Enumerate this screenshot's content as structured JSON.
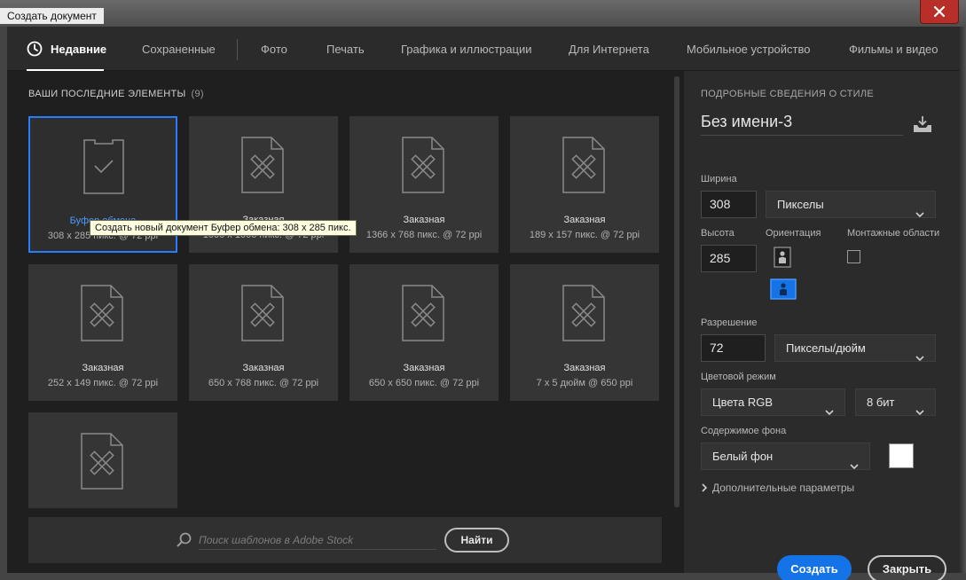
{
  "window": {
    "title": "Создать документ"
  },
  "tabs": [
    {
      "label": "Недавние",
      "icon": "clock-icon",
      "active": true
    },
    {
      "label": "Сохраненные"
    },
    {
      "label": "Фото"
    },
    {
      "label": "Печать"
    },
    {
      "label": "Графика и иллюстрации"
    },
    {
      "label": "Для Интернета"
    },
    {
      "label": "Мобильное устройство"
    },
    {
      "label": "Фильмы и видео"
    }
  ],
  "recent": {
    "heading": "ВАШИ ПОСЛЕДНИЕ ЭЛЕМЕНТЫ",
    "count": "(9)",
    "items": [
      {
        "name": "Буфер обмена",
        "dims": "308 x 285 пикс. @ 72 ppi",
        "icon": "clipboard-icon",
        "selected": true
      },
      {
        "name": "Заказная",
        "dims": "1000 x 1000 пикс. @ 72 ppi",
        "icon": "custom-document-icon"
      },
      {
        "name": "Заказная",
        "dims": "1366 x 768 пикс. @ 72 ppi",
        "icon": "custom-document-icon"
      },
      {
        "name": "Заказная",
        "dims": "189 x 157 пикс. @ 72 ppi",
        "icon": "custom-document-icon"
      },
      {
        "name": "Заказная",
        "dims": "252 x 149 пикс. @ 72 ppi",
        "icon": "custom-document-icon"
      },
      {
        "name": "Заказная",
        "dims": "650 x 768 пикс. @ 72 ppi",
        "icon": "custom-document-icon"
      },
      {
        "name": "Заказная",
        "dims": "650 x 650 пикс. @ 72 ppi",
        "icon": "custom-document-icon"
      },
      {
        "name": "Заказная",
        "dims": "7 x 5 дюйм @ 650 ppi",
        "icon": "custom-document-icon"
      },
      {
        "name": "",
        "dims": "",
        "icon": "custom-document-icon"
      }
    ],
    "tooltip": "Создать новый документ Буфер обмена: 308 x 285 пикс."
  },
  "stock": {
    "placeholder": "Поиск шаблонов в Adobe Stock",
    "find_label": "Найти"
  },
  "details": {
    "heading": "ПОДРОБНЫЕ СВЕДЕНИЯ О СТИЛЕ",
    "preset_name": "Без имени-3",
    "width_label": "Ширина",
    "width_value": "308",
    "width_unit": "Пикселы",
    "height_label": "Высота",
    "height_value": "285",
    "orientation_label": "Ориентация",
    "artboards_label": "Монтажные области",
    "resolution_label": "Разрешение",
    "resolution_value": "72",
    "resolution_unit": "Пикселы/дюйм",
    "color_mode_label": "Цветовой режим",
    "color_mode_value": "Цвета RGB",
    "bit_depth_value": "8 бит",
    "background_label": "Содержимое фона",
    "background_value": "Белый фон",
    "background_color": "#ffffff",
    "advanced_label": "Дополнительные параметры",
    "create_label": "Создать",
    "close_label": "Закрыть"
  },
  "colors": {
    "accent": "#1473e6",
    "selection": "#2a7cff",
    "dialog_bg": "#1f1f1f",
    "panel_bg": "#2b2b2b",
    "card_bg": "#353535"
  }
}
